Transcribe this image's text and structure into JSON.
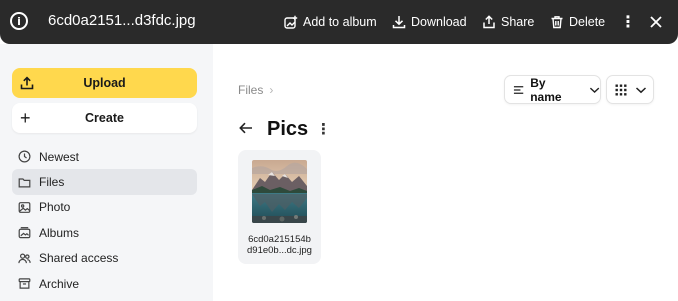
{
  "topbar": {
    "file_title": "6cd0a2151...d3fdc.jpg",
    "add_to_album": "Add to album",
    "download": "Download",
    "share": "Share",
    "delete": "Delete",
    "more": "⋮"
  },
  "sidebar": {
    "upload_label": "Upload",
    "create_label": "Create",
    "items": [
      {
        "label": "Newest",
        "icon": "clock-icon"
      },
      {
        "label": "Files",
        "icon": "folder-icon"
      },
      {
        "label": "Photo",
        "icon": "image-icon"
      },
      {
        "label": "Albums",
        "icon": "album-icon"
      },
      {
        "label": "Shared access",
        "icon": "people-icon"
      },
      {
        "label": "Archive",
        "icon": "archive-icon"
      }
    ],
    "active_item": "Files"
  },
  "main": {
    "breadcrumb": [
      "Files"
    ],
    "title": "Pics",
    "sort_label": "By name",
    "files": [
      {
        "name_line1": "6cd0a215154b",
        "name_line2": "d91e0b...dc.jpg"
      }
    ]
  },
  "colors": {
    "topbar_bg": "#2a2a2a",
    "upload_bg": "#ffd84d",
    "sidebar_bg": "#f5f6f8",
    "active_bg": "#e4e6ea"
  }
}
